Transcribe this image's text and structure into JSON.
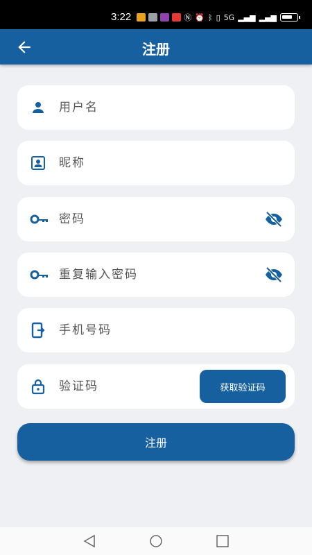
{
  "status_bar": {
    "time": "3:22",
    "network_label": "5G",
    "icons": [
      "nfc-icon",
      "alarm-icon",
      "vibrate-icon",
      "bluetooth-icon",
      "signal-icon",
      "wifi-icon",
      "battery-icon"
    ]
  },
  "header": {
    "title": "注册",
    "back_icon": "arrow-left-icon"
  },
  "form": {
    "username": {
      "placeholder": "用户名",
      "value": "",
      "icon": "person-icon"
    },
    "nickname": {
      "placeholder": "昵称",
      "value": "",
      "icon": "id-card-icon"
    },
    "password": {
      "placeholder": "密码",
      "value": "",
      "icon": "key-icon",
      "toggle_icon": "eye-off-icon"
    },
    "confirm_password": {
      "placeholder": "重复输入密码",
      "value": "",
      "icon": "key-icon",
      "toggle_icon": "eye-off-icon"
    },
    "phone": {
      "placeholder": "手机号码",
      "value": "",
      "icon": "phone-exit-icon"
    },
    "code": {
      "placeholder": "验证码",
      "value": "",
      "icon": "lock-icon",
      "button_label": "获取验证码"
    }
  },
  "submit_label": "注册",
  "colors": {
    "primary": "#1660a0",
    "background": "#eef0f4",
    "field": "#ffffff"
  }
}
